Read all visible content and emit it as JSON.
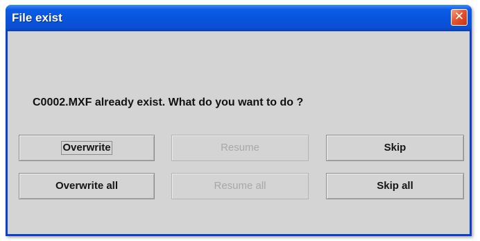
{
  "dialog": {
    "title": "File exist",
    "close_icon": "close-icon"
  },
  "message": "C0002.MXF already exist. What do you want to do ?",
  "buttons": {
    "overwrite": "Overwrite",
    "resume": "Resume",
    "skip": "Skip",
    "overwrite_all": "Overwrite all",
    "resume_all": "Resume all",
    "skip_all": "Skip all"
  },
  "colors": {
    "titlebar": "#0855dd",
    "close_button": "#e2562e",
    "dialog_background": "#d4d4d4",
    "disabled_text": "#a8a8a8"
  }
}
